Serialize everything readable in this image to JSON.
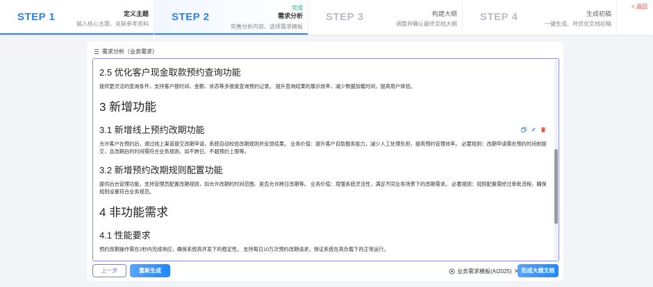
{
  "steps": [
    {
      "num": "STEP 1",
      "title": "定义主题",
      "done": "",
      "desc": "输入核心主题、关联参考资料"
    },
    {
      "num": "STEP 2",
      "title": "需求分析",
      "done": "完成",
      "desc": "完善分析内容、选择需求模板"
    },
    {
      "num": "STEP 3",
      "title": "构建大纲",
      "done": "",
      "desc": "调整并确认最终文档大纲"
    },
    {
      "num": "STEP 4",
      "title": "生成初稿",
      "done": "",
      "desc": "一键生成、并优化文档初稿"
    }
  ],
  "back_label": "< 返回",
  "card": {
    "heading": "需求分析（业务需求）",
    "content": [
      {
        "type": "h2",
        "text": "2.5 优化客户现金取款预约查询功能"
      },
      {
        "type": "p",
        "text": "提供更灵活的查询条件，支持客户按时间、金额、状态等多维度查询预约记录。 提升查询结果的展示效率，减少数据加载时间，提高用户体验。"
      },
      {
        "type": "h1",
        "text": "3 新增功能"
      },
      {
        "type": "h2",
        "text": "3.1 新增线上预约改期功能"
      },
      {
        "type": "p",
        "text": "允许客户在预约后，通过线上渠道提交改期申请，系统自动校验改期规则并反馈结果。 业务价值：提升客户自助服务能力，减少人工处理负担，提高预约管理效率。 必要规则：改期申请需在预约时间前提交，且改期后的时间需符合业务规则，如不跨日、不超预约上限等。"
      },
      {
        "type": "h2",
        "text": "3.2 新增预约改期规则配置功能"
      },
      {
        "type": "p",
        "text": "提供后台管理功能，支持管理员配置改期规则，如允许改期的时间范围、是否允许跨日改期等。 业务价值：增强系统灵活性，满足不同业务场景下的改期需求。 必要规则：规则配置需经过审批流程，确保规则设置符合业务规范。"
      },
      {
        "type": "h1",
        "text": "4 非功能需求"
      },
      {
        "type": "h2",
        "text": "4.1 性能要求"
      },
      {
        "type": "p",
        "text": "预约改期操作需在2秒内完成响应，确保系统高并发下的稳定性。 支持每日10万次预约改期请求，保证系统在高负载下的正常运行。"
      }
    ]
  },
  "footer": {
    "prev_label": "上一步",
    "regen_label": "重新生成",
    "template_label": "业务需求模板(AI2025)",
    "generate_label": "形成大纲文档"
  },
  "colors": {
    "accent": "#2e7ff5",
    "done": "#19b87a",
    "back": "#e53935",
    "editor_border": "#8a8cf0"
  },
  "icons": [
    "list-icon",
    "copy-icon",
    "edit-icon",
    "delete-icon",
    "template-icon",
    "close-icon"
  ]
}
